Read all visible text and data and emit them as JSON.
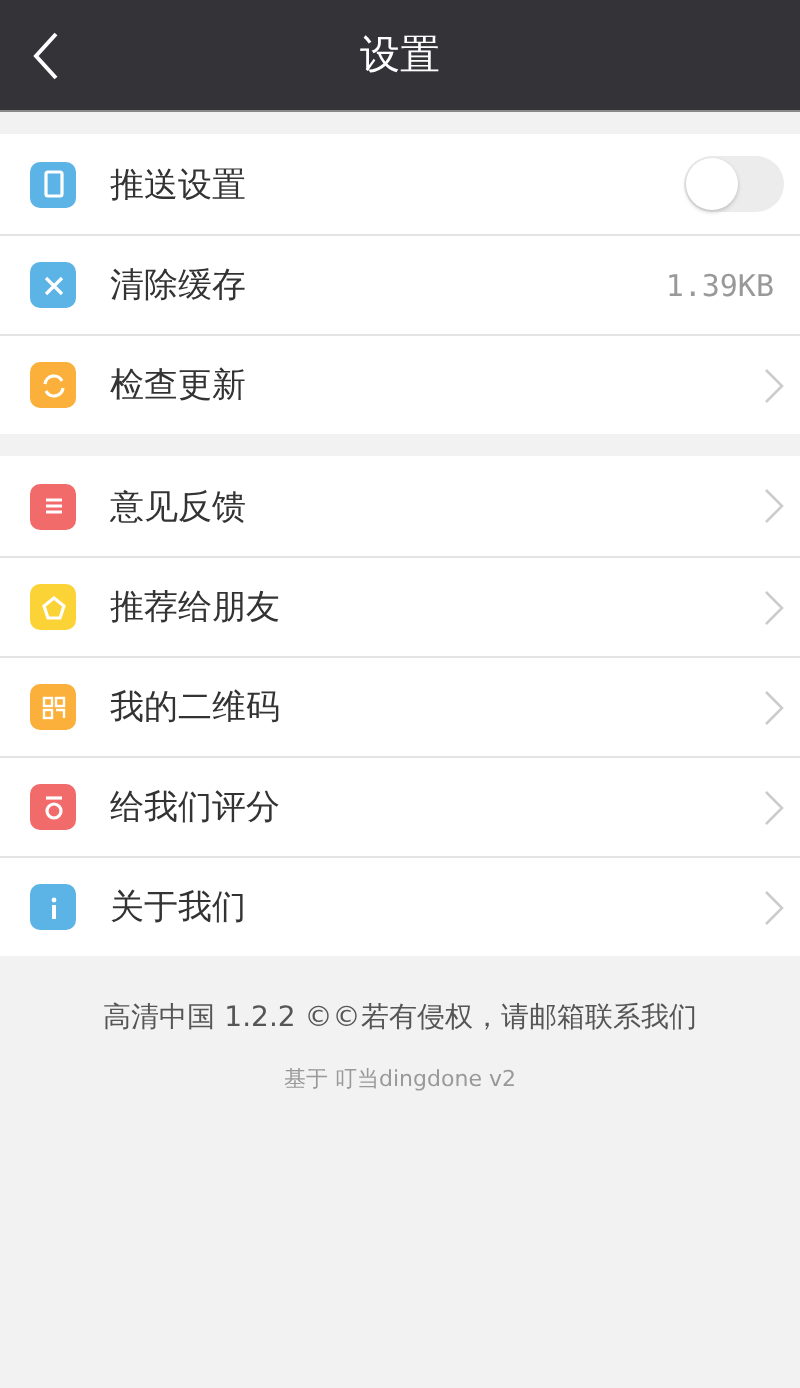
{
  "header": {
    "title": "设置"
  },
  "groups": [
    {
      "items": [
        {
          "kind": "switch",
          "color": "#5bb4e5",
          "label": "推送设置",
          "on": false
        },
        {
          "kind": "value",
          "color": "#5bb4e5",
          "label": "清除缓存",
          "value": "1.39KB"
        },
        {
          "kind": "link",
          "color": "#fbb03b",
          "label": "检查更新"
        }
      ]
    },
    {
      "items": [
        {
          "kind": "link",
          "color": "#f26b6b",
          "label": "意见反馈"
        },
        {
          "kind": "link",
          "color": "#fcd336",
          "label": "推荐给朋友"
        },
        {
          "kind": "link",
          "color": "#fbb03b",
          "label": "我的二维码"
        },
        {
          "kind": "link",
          "color": "#f26b6b",
          "label": "给我们评分"
        },
        {
          "kind": "link",
          "color": "#5bb4e5",
          "label": "关于我们"
        }
      ]
    }
  ],
  "footer": {
    "line": "高清中国 1.2.2 ©©若有侵权，请邮箱联系我们",
    "credit": "基于 叮当dingdone v2"
  }
}
